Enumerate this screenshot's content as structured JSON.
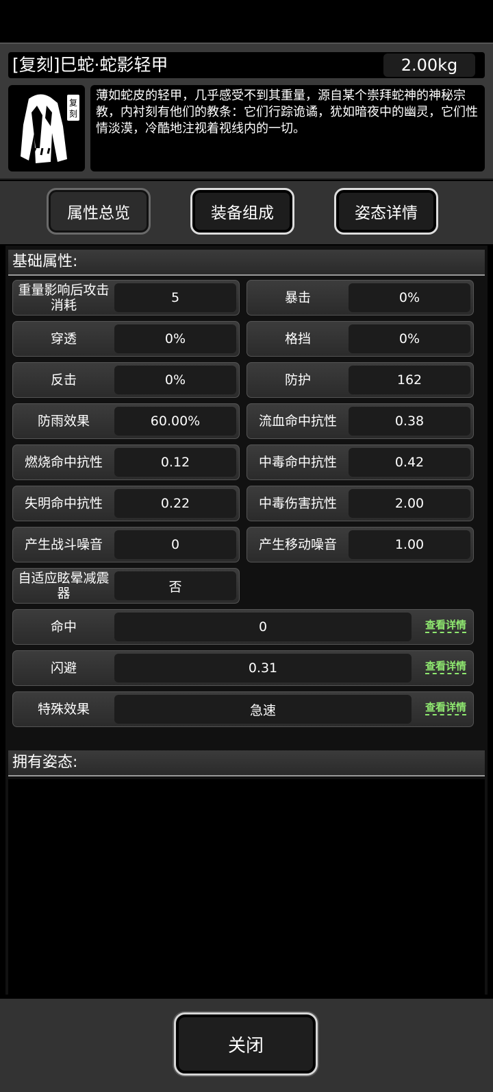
{
  "item": {
    "name": "[复刻]巳蛇·蛇影轻甲",
    "weight": "2.00kg",
    "badge": "复刻",
    "description": "薄如蛇皮的轻甲，几乎感受不到其重量，源自某个崇拜蛇神的神秘宗教，内衬刻有他们的教条：它们行踪诡谲，犹如暗夜中的幽灵，它们性情淡漠，冷酷地注视着视线内的一切。",
    "icon": "armor-cloak-icon"
  },
  "tabs": [
    {
      "label": "属性总览"
    },
    {
      "label": "装备组成"
    },
    {
      "label": "姿态详情"
    }
  ],
  "basic": {
    "header": "基础属性:",
    "stats": [
      {
        "label": "重量影响后攻击消耗",
        "value": "5"
      },
      {
        "label": "暴击",
        "value": "0%"
      },
      {
        "label": "穿透",
        "value": "0%"
      },
      {
        "label": "格挡",
        "value": "0%"
      },
      {
        "label": "反击",
        "value": "0%"
      },
      {
        "label": "防护",
        "value": "162"
      },
      {
        "label": "防雨效果",
        "value": "60.00%"
      },
      {
        "label": "流血命中抗性",
        "value": "0.38"
      },
      {
        "label": "燃烧命中抗性",
        "value": "0.12"
      },
      {
        "label": "中毒命中抗性",
        "value": "0.42"
      },
      {
        "label": "失明命中抗性",
        "value": "0.22"
      },
      {
        "label": "中毒伤害抗性",
        "value": "2.00"
      },
      {
        "label": "产生战斗噪音",
        "value": "0"
      },
      {
        "label": "产生移动噪音",
        "value": "1.00"
      },
      {
        "label": "自适应眩晕减震器",
        "value": "否"
      }
    ],
    "wide": [
      {
        "label": "命中",
        "value": "0",
        "link": "查看详情"
      },
      {
        "label": "闪避",
        "value": "0.31",
        "link": "查看详情"
      },
      {
        "label": "特殊效果",
        "value": "急速",
        "link": "查看详情"
      }
    ]
  },
  "stances": {
    "header": "拥有姿态:"
  },
  "footer": {
    "close_label": "关闭"
  },
  "colors": {
    "link": "#8fe870",
    "panel": "#3a3a3a",
    "cell_value_bg": "#1c1c1c"
  }
}
